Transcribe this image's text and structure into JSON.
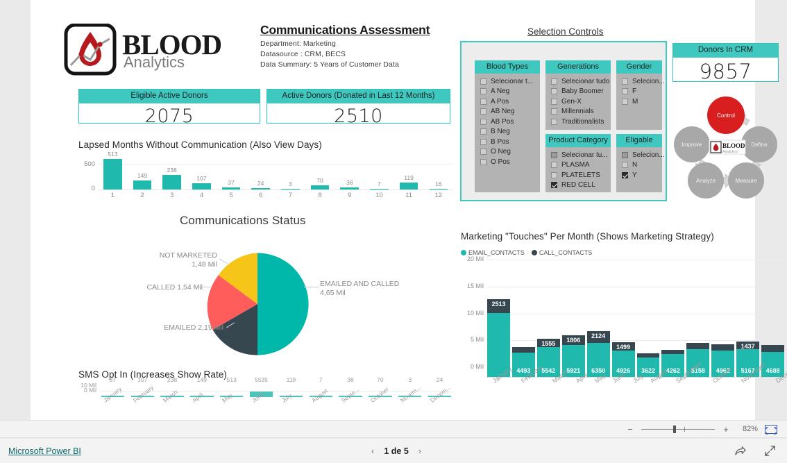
{
  "brand": {
    "logo_primary": "BLOOD",
    "logo_secondary": "Analytics",
    "logo_icon": "blood-drop-analytics-logo"
  },
  "header": {
    "title": "Communications Assessment",
    "department": "Department: Marketing",
    "datasource": "Datasource : CRM, BECS",
    "summary": "Data Summary: 5 Years of Customer Data"
  },
  "kpis": [
    {
      "id": "eligible-active-donors",
      "label": "Eligible Active Donors",
      "value": "2075"
    },
    {
      "id": "active-donors-12m",
      "label": "Active Donors (Donated in Last 12 Months)",
      "value": "2510"
    },
    {
      "id": "donors-in-crm",
      "label": "Donors In CRM",
      "value": "9857"
    }
  ],
  "selection_controls": {
    "title": "Selection Controls",
    "slicers": [
      {
        "id": "blood-types",
        "title": "Blood Types",
        "options": [
          {
            "label": "Selecionar t...",
            "state": "unchecked"
          },
          {
            "label": "A Neg",
            "state": "unchecked"
          },
          {
            "label": "A Pos",
            "state": "unchecked"
          },
          {
            "label": "AB Neg",
            "state": "unchecked"
          },
          {
            "label": "AB Pos",
            "state": "unchecked"
          },
          {
            "label": "B Neg",
            "state": "unchecked"
          },
          {
            "label": "B Pos",
            "state": "unchecked"
          },
          {
            "label": "O Neg",
            "state": "unchecked"
          },
          {
            "label": "O Pos",
            "state": "unchecked"
          }
        ]
      },
      {
        "id": "generations",
        "title": "Generations",
        "options": [
          {
            "label": "Selecionar tudo",
            "state": "unchecked"
          },
          {
            "label": "Baby Boomer",
            "state": "unchecked"
          },
          {
            "label": "Gen-X",
            "state": "unchecked"
          },
          {
            "label": "Millennials",
            "state": "unchecked"
          },
          {
            "label": "Traditionalists",
            "state": "unchecked"
          }
        ]
      },
      {
        "id": "gender",
        "title": "Gender",
        "options": [
          {
            "label": "Selecion...",
            "state": "unchecked"
          },
          {
            "label": "F",
            "state": "unchecked"
          },
          {
            "label": "M",
            "state": "unchecked"
          }
        ]
      },
      {
        "id": "product-category",
        "title": "Product Category",
        "options": [
          {
            "label": "Selecionar tu...",
            "state": "partial"
          },
          {
            "label": "PLASMA",
            "state": "unchecked"
          },
          {
            "label": "PLATELETS",
            "state": "unchecked"
          },
          {
            "label": "RED CELL",
            "state": "checked"
          }
        ]
      },
      {
        "id": "eligable",
        "title": "Eligable",
        "options": [
          {
            "label": "Selecion...",
            "state": "partial"
          },
          {
            "label": "N",
            "state": "unchecked"
          },
          {
            "label": "Y",
            "state": "checked"
          }
        ]
      }
    ]
  },
  "dmaic": {
    "name": "dmaic-cycle-diagram",
    "center_label_primary": "BLOOD",
    "center_label_secondary": "Analytics",
    "nodes": [
      {
        "label": "Control",
        "color": "#d81e1e",
        "active": true
      },
      {
        "label": "Define",
        "color": "#a8a8a8",
        "active": false
      },
      {
        "label": "Measure",
        "color": "#a8a8a8",
        "active": false
      },
      {
        "label": "Analyze",
        "color": "#a8a8a8",
        "active": false
      },
      {
        "label": "Improve",
        "color": "#a8a8a8",
        "active": false
      }
    ]
  },
  "chart_data": [
    {
      "id": "lapsed-months",
      "type": "bar",
      "title": "Lapsed Months Without Communication (Also View Days)",
      "categories": [
        "1",
        "2",
        "3",
        "4",
        "5",
        "6",
        "7",
        "8",
        "9",
        "10",
        "11",
        "12"
      ],
      "values": [
        513,
        149,
        238,
        107,
        37,
        24,
        3,
        70,
        38,
        7,
        119,
        16
      ],
      "xlabel": "",
      "ylabel": "",
      "ylim": [
        0,
        600
      ],
      "yticks": [
        "0",
        "500"
      ],
      "grid": true,
      "color": "#1fb9ad"
    },
    {
      "id": "communications-status",
      "type": "pie",
      "title": "Communications Status",
      "categories": [
        "EMAILED AND CALLED",
        "EMAILED",
        "CALLED",
        "NOT MARKETED"
      ],
      "values": [
        4.65,
        2.19,
        1.54,
        1.48
      ],
      "value_labels": [
        "4,65 Mil",
        "2,19 Mil",
        "1,54 Mil",
        "1,48 Mil"
      ],
      "labels_full": [
        "EMAILED AND CALLED 4,65 Mil",
        "EMAILED 2,19 Mil",
        "CALLED 1,54 Mil",
        "NOT MARKETED 1,48 Mil"
      ],
      "colors": [
        "#00b8a9",
        "#37474f",
        "#ff5c5c",
        "#f5c518"
      ],
      "legend": "none"
    },
    {
      "id": "marketing-touches-per-month",
      "type": "bar",
      "title": "Marketing \"Touches\" Per Month (Shows Marketing Strategy)",
      "stacked": true,
      "categories": [
        "January",
        "February",
        "March",
        "April",
        "May",
        "June",
        "July",
        "August",
        "September",
        "October",
        "November",
        "December"
      ],
      "series": [
        {
          "name": "EMAIL_CONTACTS",
          "color": "#1fb9ad",
          "values": [
            11900,
            4493,
            5542,
            5921,
            6350,
            4926,
            3622,
            4262,
            5158,
            4962,
            5167,
            4688
          ],
          "labels": [
            "",
            "4493",
            "5542",
            "5921",
            "6350",
            "4926",
            "3622",
            "4262",
            "5158",
            "4962",
            "5167",
            "4688"
          ]
        },
        {
          "name": "CALL_CONTACTS",
          "color": "#37474f",
          "values": [
            2513,
            1100,
            1555,
            1806,
            2124,
            1499,
            780,
            820,
            1150,
            1120,
            1437,
            1280
          ],
          "labels": [
            "2513",
            "",
            "1555",
            "1806",
            "2124",
            "1499",
            "",
            "",
            "",
            "",
            "1437",
            ""
          ]
        }
      ],
      "ylim": [
        0,
        20
      ],
      "yticks": [
        "0 Mil",
        "5 Mil",
        "10 Mil",
        "15 Mil",
        "20 Mil"
      ],
      "ylabel": "",
      "xlabel": "",
      "legend": "top-left",
      "grid": true
    },
    {
      "id": "sms-opt-in",
      "type": "bar",
      "title": "SMS Opt In (Increases Show Rate)",
      "categories": [
        "January",
        "February",
        "March",
        "April",
        "May",
        "June",
        "July",
        "August",
        "Septe...",
        "October",
        "Novem...",
        "Decem..."
      ],
      "values": [
        37,
        107,
        238,
        149,
        513,
        5535,
        119,
        7,
        38,
        70,
        3,
        24
      ],
      "yticks": [
        "0 Mil",
        "10 Mil"
      ],
      "ylim": [
        0,
        10
      ],
      "color": "#4ec3bb",
      "grid": true
    }
  ],
  "zoombar": {
    "minus": "−",
    "plus": "+",
    "percent": "82%",
    "fit_icon": "fit-to-page-icon"
  },
  "footer": {
    "powerbi_link": "Microsoft Power BI",
    "prev_icon": "chevron-left-icon",
    "next_icon": "chevron-right-icon",
    "page_text": "1 de 5",
    "share_icon": "share-icon",
    "fullscreen_icon": "fullscreen-icon"
  }
}
